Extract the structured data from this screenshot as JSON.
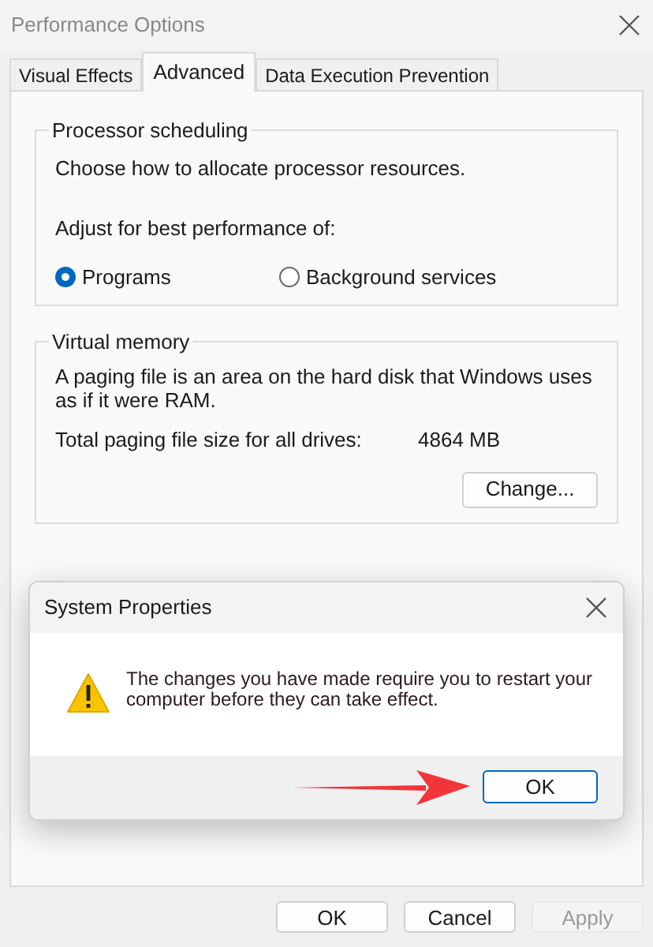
{
  "window": {
    "title": "Performance Options"
  },
  "tabs": [
    {
      "label": "Visual Effects",
      "selected": false
    },
    {
      "label": "Advanced",
      "selected": true
    },
    {
      "label": "Data Execution Prevention",
      "selected": false
    }
  ],
  "processor_scheduling": {
    "title": "Processor scheduling",
    "description": "Choose how to allocate processor resources.",
    "prompt": "Adjust for best performance of:",
    "options": [
      {
        "label": "Programs",
        "selected": true
      },
      {
        "label": "Background services",
        "selected": false
      }
    ]
  },
  "virtual_memory": {
    "title": "Virtual memory",
    "description": "A paging file is an area on the hard disk that Windows uses as if it were RAM.",
    "size_label": "Total paging file size for all drives:",
    "size_value": "4864 MB",
    "button": "Change..."
  },
  "buttons": [
    {
      "label": "OK",
      "disabled": false
    },
    {
      "label": "Cancel",
      "disabled": false
    },
    {
      "label": "Apply",
      "disabled": true
    }
  ],
  "dialog": {
    "title": "System Properties",
    "message": "The changes you have made require you to restart your computer before they can take effect.",
    "button": "OK"
  }
}
